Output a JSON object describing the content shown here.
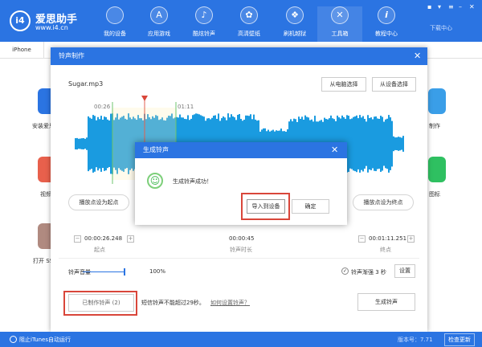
{
  "app": {
    "logo": "i4",
    "title": "爱思助手",
    "url": "www.i4.cn"
  },
  "nav": [
    {
      "label": "我的设备",
      "icon": "apple-icon"
    },
    {
      "label": "应用游戏",
      "icon": "app-store-icon"
    },
    {
      "label": "酷炫铃声",
      "icon": "bell-icon"
    },
    {
      "label": "高清壁纸",
      "icon": "flower-icon"
    },
    {
      "label": "刷机越狱",
      "icon": "dropbox-icon"
    },
    {
      "label": "工具箱",
      "icon": "tools-icon"
    },
    {
      "label": "教程中心",
      "icon": "info-icon"
    }
  ],
  "download_center": "下载中心",
  "tab": "iPhone",
  "background_apps": {
    "left": [
      "安装爱思",
      "视频",
      "打开 SS"
    ],
    "right": [
      "制作",
      "图标"
    ]
  },
  "ringtone_dialog": {
    "title": "铃声制作",
    "file": "Sugar.mp3",
    "from_pc": "从电脑选择",
    "from_device": "从设备选择",
    "marker_start": "00:26",
    "marker_end": "01:11",
    "set_start": "播放点设为起点",
    "set_end": "播放点设为终点",
    "start_time": "00:00:26.248",
    "start_label": "起点",
    "duration": "00:00:45",
    "duration_label": "铃声时长",
    "end_time": "00:01:11.251",
    "end_label": "终点",
    "volume_label": "铃声音量",
    "volume_value": "100%",
    "volume_fraction": 1.0,
    "fade_label": "铃声渐强 3 秒",
    "fade_checked": true,
    "settings": "设置",
    "made_ringtones": "已制作铃声 (2)",
    "sms_note": "短信铃声不能超过29秒。",
    "howto_link": "如何设置铃声？",
    "generate": "生成铃声"
  },
  "success_popup": {
    "title": "生成铃声",
    "message": "生成铃声成功！",
    "import": "导入到设备",
    "ok": "确定"
  },
  "status": {
    "block_itunes": "阻止iTunes自动运行",
    "version": "版本号：7.71",
    "check_update": "检查更新"
  },
  "colors": {
    "primary": "#2b74e2",
    "waveform": "#1a9be0",
    "highlight": "#d9463a"
  }
}
